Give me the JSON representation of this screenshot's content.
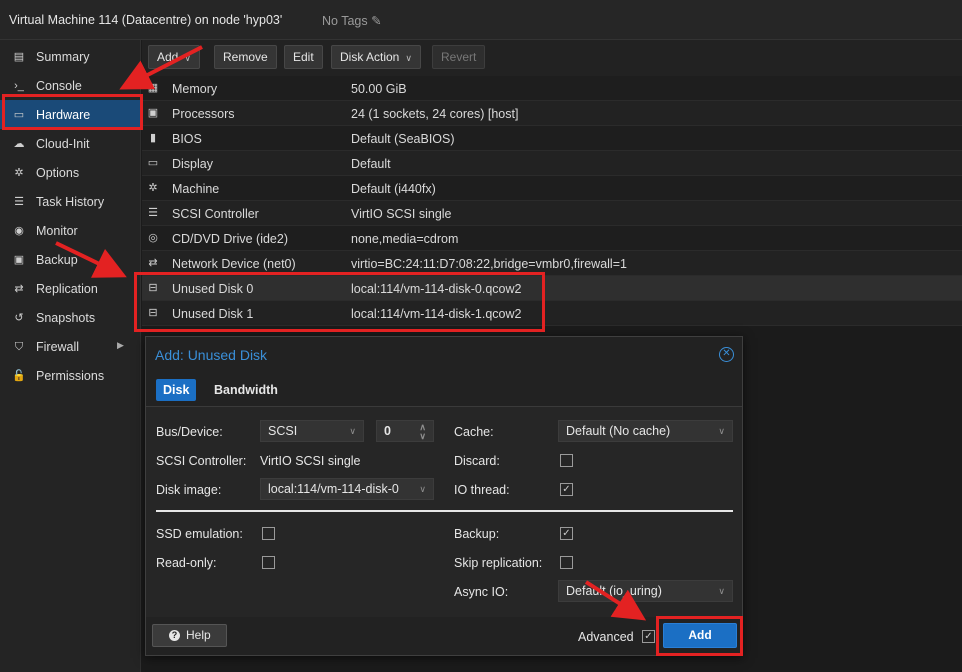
{
  "topbar": {
    "title": "Virtual Machine 114 (Datacentre) on node 'hyp03'",
    "tags": "No Tags"
  },
  "sidebar": {
    "items": [
      {
        "label": "Summary",
        "icon": "book-icon",
        "glyph": "▤"
      },
      {
        "label": "Console",
        "icon": "terminal-icon",
        "glyph": "›_"
      },
      {
        "label": "Hardware",
        "icon": "desktop-icon",
        "glyph": "▭"
      },
      {
        "label": "Cloud-Init",
        "icon": "cloud-icon",
        "glyph": "☁"
      },
      {
        "label": "Options",
        "icon": "gear-icon",
        "glyph": "✲"
      },
      {
        "label": "Task History",
        "icon": "list-icon",
        "glyph": "☰"
      },
      {
        "label": "Monitor",
        "icon": "eye-icon",
        "glyph": "◉"
      },
      {
        "label": "Backup",
        "icon": "floppy-icon",
        "glyph": "▣"
      },
      {
        "label": "Replication",
        "icon": "retweet-icon",
        "glyph": "⇄"
      },
      {
        "label": "Snapshots",
        "icon": "history-icon",
        "glyph": "↺"
      },
      {
        "label": "Firewall",
        "icon": "shield-icon",
        "glyph": "⛉"
      },
      {
        "label": "Permissions",
        "icon": "unlock-icon",
        "glyph": "🔓"
      }
    ],
    "active": "Hardware"
  },
  "toolbar": {
    "add": "Add",
    "remove": "Remove",
    "edit": "Edit",
    "disk_action": "Disk Action",
    "revert": "Revert"
  },
  "hardware": [
    {
      "name": "Memory",
      "value": "50.00 GiB",
      "icon": "memory-icon",
      "glyph": "▦"
    },
    {
      "name": "Processors",
      "value": "24 (1 sockets, 24 cores) [host]",
      "icon": "cpu-icon",
      "glyph": "▣"
    },
    {
      "name": "BIOS",
      "value": "Default (SeaBIOS)",
      "icon": "microchip-icon",
      "glyph": "▮"
    },
    {
      "name": "Display",
      "value": "Default",
      "icon": "monitor-icon",
      "glyph": "▭"
    },
    {
      "name": "Machine",
      "value": "Default (i440fx)",
      "icon": "cogs-icon",
      "glyph": "✲"
    },
    {
      "name": "SCSI Controller",
      "value": "VirtIO SCSI single",
      "icon": "database-icon",
      "glyph": "☰"
    },
    {
      "name": "CD/DVD Drive (ide2)",
      "value": "none,media=cdrom",
      "icon": "cdrom-icon",
      "glyph": "◎"
    },
    {
      "name": "Network Device (net0)",
      "value": "virtio=BC:24:11:D7:08:22,bridge=vmbr0,firewall=1",
      "icon": "exchange-icon",
      "glyph": "⇄"
    },
    {
      "name": "Unused Disk 0",
      "value": "local:114/vm-114-disk-0.qcow2",
      "icon": "hdd-icon",
      "glyph": "⊟"
    },
    {
      "name": "Unused Disk 1",
      "value": "local:114/vm-114-disk-1.qcow2",
      "icon": "hdd-icon",
      "glyph": "⊟"
    }
  ],
  "dialog": {
    "title": "Add: Unused Disk",
    "tabs": [
      "Disk",
      "Bandwidth"
    ],
    "bus_device_label": "Bus/Device:",
    "bus_value": "SCSI",
    "device_value": "0",
    "scsi_controller_label": "SCSI Controller:",
    "scsi_controller_value": "VirtIO SCSI single",
    "disk_image_label": "Disk image:",
    "disk_image_value": "local:114/vm-114-disk-0",
    "cache_label": "Cache:",
    "cache_value": "Default (No cache)",
    "discard_label": "Discard:",
    "discard_checked": false,
    "io_thread_label": "IO thread:",
    "io_thread_checked": true,
    "ssd_label": "SSD emulation:",
    "ssd_checked": false,
    "readonly_label": "Read-only:",
    "readonly_checked": false,
    "backup_label": "Backup:",
    "backup_checked": true,
    "skip_repl_label": "Skip replication:",
    "skip_repl_checked": false,
    "async_io_label": "Async IO:",
    "async_io_value": "Default (io_uring)",
    "help": "Help",
    "advanced_label": "Advanced",
    "advanced_checked": true,
    "add_button": "Add"
  },
  "colors": {
    "accent": "#1b6fc4",
    "annotation": "#e32222",
    "active_nav": "#1a4a78"
  }
}
